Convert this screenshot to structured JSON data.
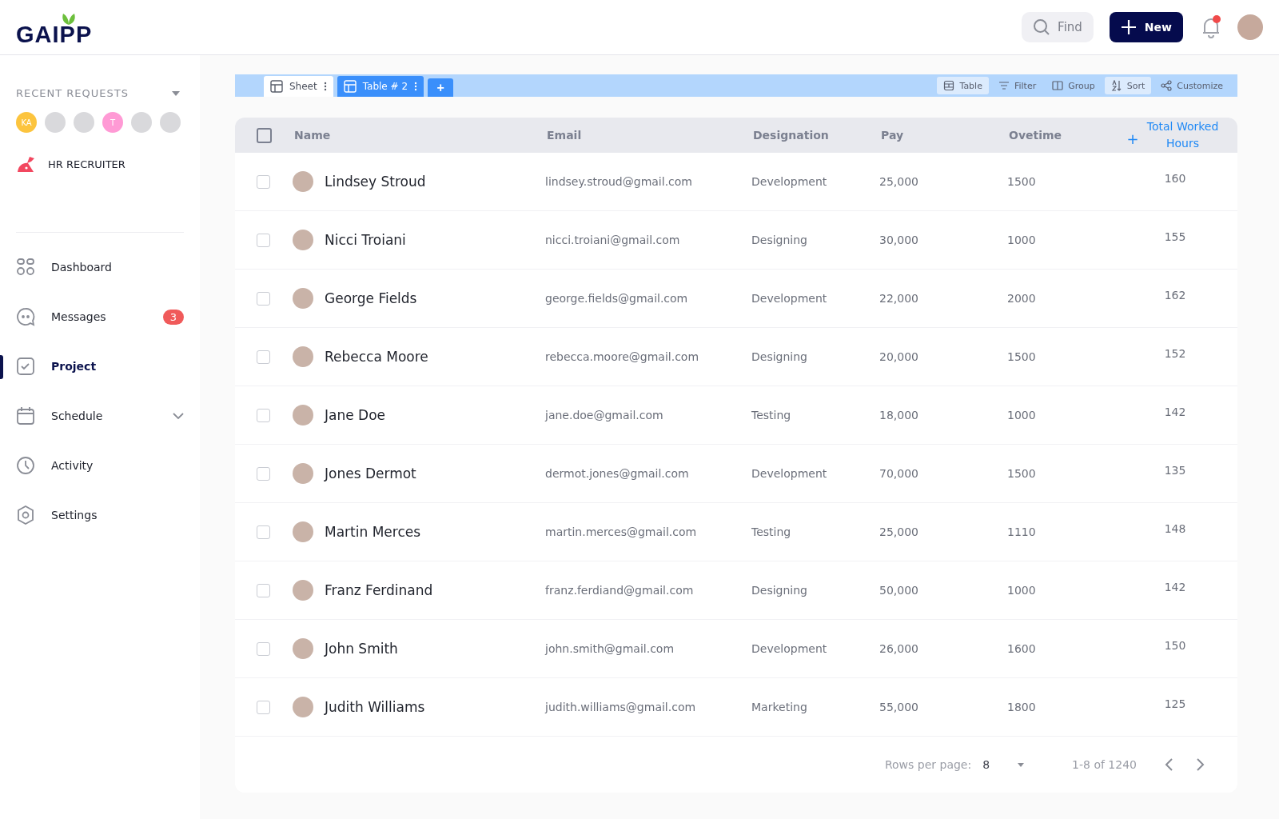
{
  "header": {
    "logo": "GAIPP",
    "find": "Find",
    "new_button": "New",
    "notification_unread": true
  },
  "sidebar": {
    "recent_title": "RECENT REQUESTS",
    "recent": [
      {
        "kind": "initials",
        "text": "KA",
        "color": "#fcc43e"
      },
      {
        "kind": "photo"
      },
      {
        "kind": "photo"
      },
      {
        "kind": "initials",
        "text": "T",
        "color": "#ff9ad5"
      },
      {
        "kind": "photo"
      },
      {
        "kind": "photo"
      }
    ],
    "role": "HR RECRUITER",
    "items": [
      {
        "kind": "dashboard",
        "label": "Dashboard",
        "selected": false
      },
      {
        "kind": "messages",
        "label": "Messages",
        "badge": "3",
        "selected": false
      },
      {
        "kind": "project",
        "label": "Project",
        "selected": true
      },
      {
        "kind": "schedule",
        "label": "Schedule",
        "selected": false,
        "expandable": true
      },
      {
        "kind": "activity",
        "label": "Activity",
        "selected": false
      },
      {
        "kind": "settings",
        "label": "Settings",
        "selected": false
      }
    ]
  },
  "tabs": [
    {
      "label": "Sheet",
      "selected": true
    },
    {
      "label": "Table # 2",
      "selected": false
    }
  ],
  "add_tab": "+",
  "tools": [
    {
      "kind": "table",
      "label": "Table",
      "selected": true
    },
    {
      "kind": "filter",
      "label": "Filter",
      "selected": false
    },
    {
      "kind": "group",
      "label": "Group",
      "selected": false
    },
    {
      "kind": "sort",
      "label": "Sort",
      "selected": true
    },
    {
      "kind": "customize",
      "label": "Customize",
      "selected": false
    }
  ],
  "table": {
    "all_checked": false,
    "add_column_icon": "+",
    "columns": [
      "Name",
      "Email",
      "Designation",
      "Pay",
      "Ovetime"
    ],
    "add_column": "Total Worked Hours",
    "rows": [
      {
        "name": "Lindsey Stroud",
        "email": "lindsey.stroud@gmail.com",
        "designation": "Development",
        "pay": "25,000",
        "overtime": "1500",
        "hours": "160",
        "checked": false
      },
      {
        "name": "Nicci Troiani",
        "email": "nicci.troiani@gmail.com",
        "designation": "Designing",
        "pay": "30,000",
        "overtime": "1000",
        "hours": "155",
        "checked": false
      },
      {
        "name": "George Fields",
        "email": "george.fields@gmail.com",
        "designation": "Development",
        "pay": "22,000",
        "overtime": "2000",
        "hours": "162",
        "checked": false
      },
      {
        "name": "Rebecca Moore",
        "email": "rebecca.moore@gmail.com",
        "designation": "Designing",
        "pay": "20,000",
        "overtime": "1500",
        "hours": "152",
        "checked": false
      },
      {
        "name": "Jane Doe",
        "email": "jane.doe@gmail.com",
        "designation": "Testing",
        "pay": "18,000",
        "overtime": "1000",
        "hours": "142",
        "checked": false
      },
      {
        "name": "Jones Dermot",
        "email": "dermot.jones@gmail.com",
        "designation": "Development",
        "pay": "70,000",
        "overtime": "1500",
        "hours": "135",
        "checked": false
      },
      {
        "name": "Martin Merces",
        "email": "martin.merces@gmail.com",
        "designation": "Testing",
        "pay": "25,000",
        "overtime": "1110",
        "hours": "148",
        "checked": false
      },
      {
        "name": "Franz Ferdinand",
        "email": "franz.ferdiand@gmail.com",
        "designation": "Designing",
        "pay": "50,000",
        "overtime": "1000",
        "hours": "142",
        "checked": false
      },
      {
        "name": "John Smith",
        "email": "john.smith@gmail.com",
        "designation": "Development",
        "pay": "26,000",
        "overtime": "1600",
        "hours": "150",
        "checked": false
      },
      {
        "name": "Judith Williams",
        "email": "judith.williams@gmail.com",
        "designation": "Marketing",
        "pay": "55,000",
        "overtime": "1800",
        "hours": "125",
        "checked": false
      }
    ]
  },
  "pagination": {
    "label": "Rows per page:",
    "per_page": "8",
    "range": "1-8 of 1240"
  }
}
